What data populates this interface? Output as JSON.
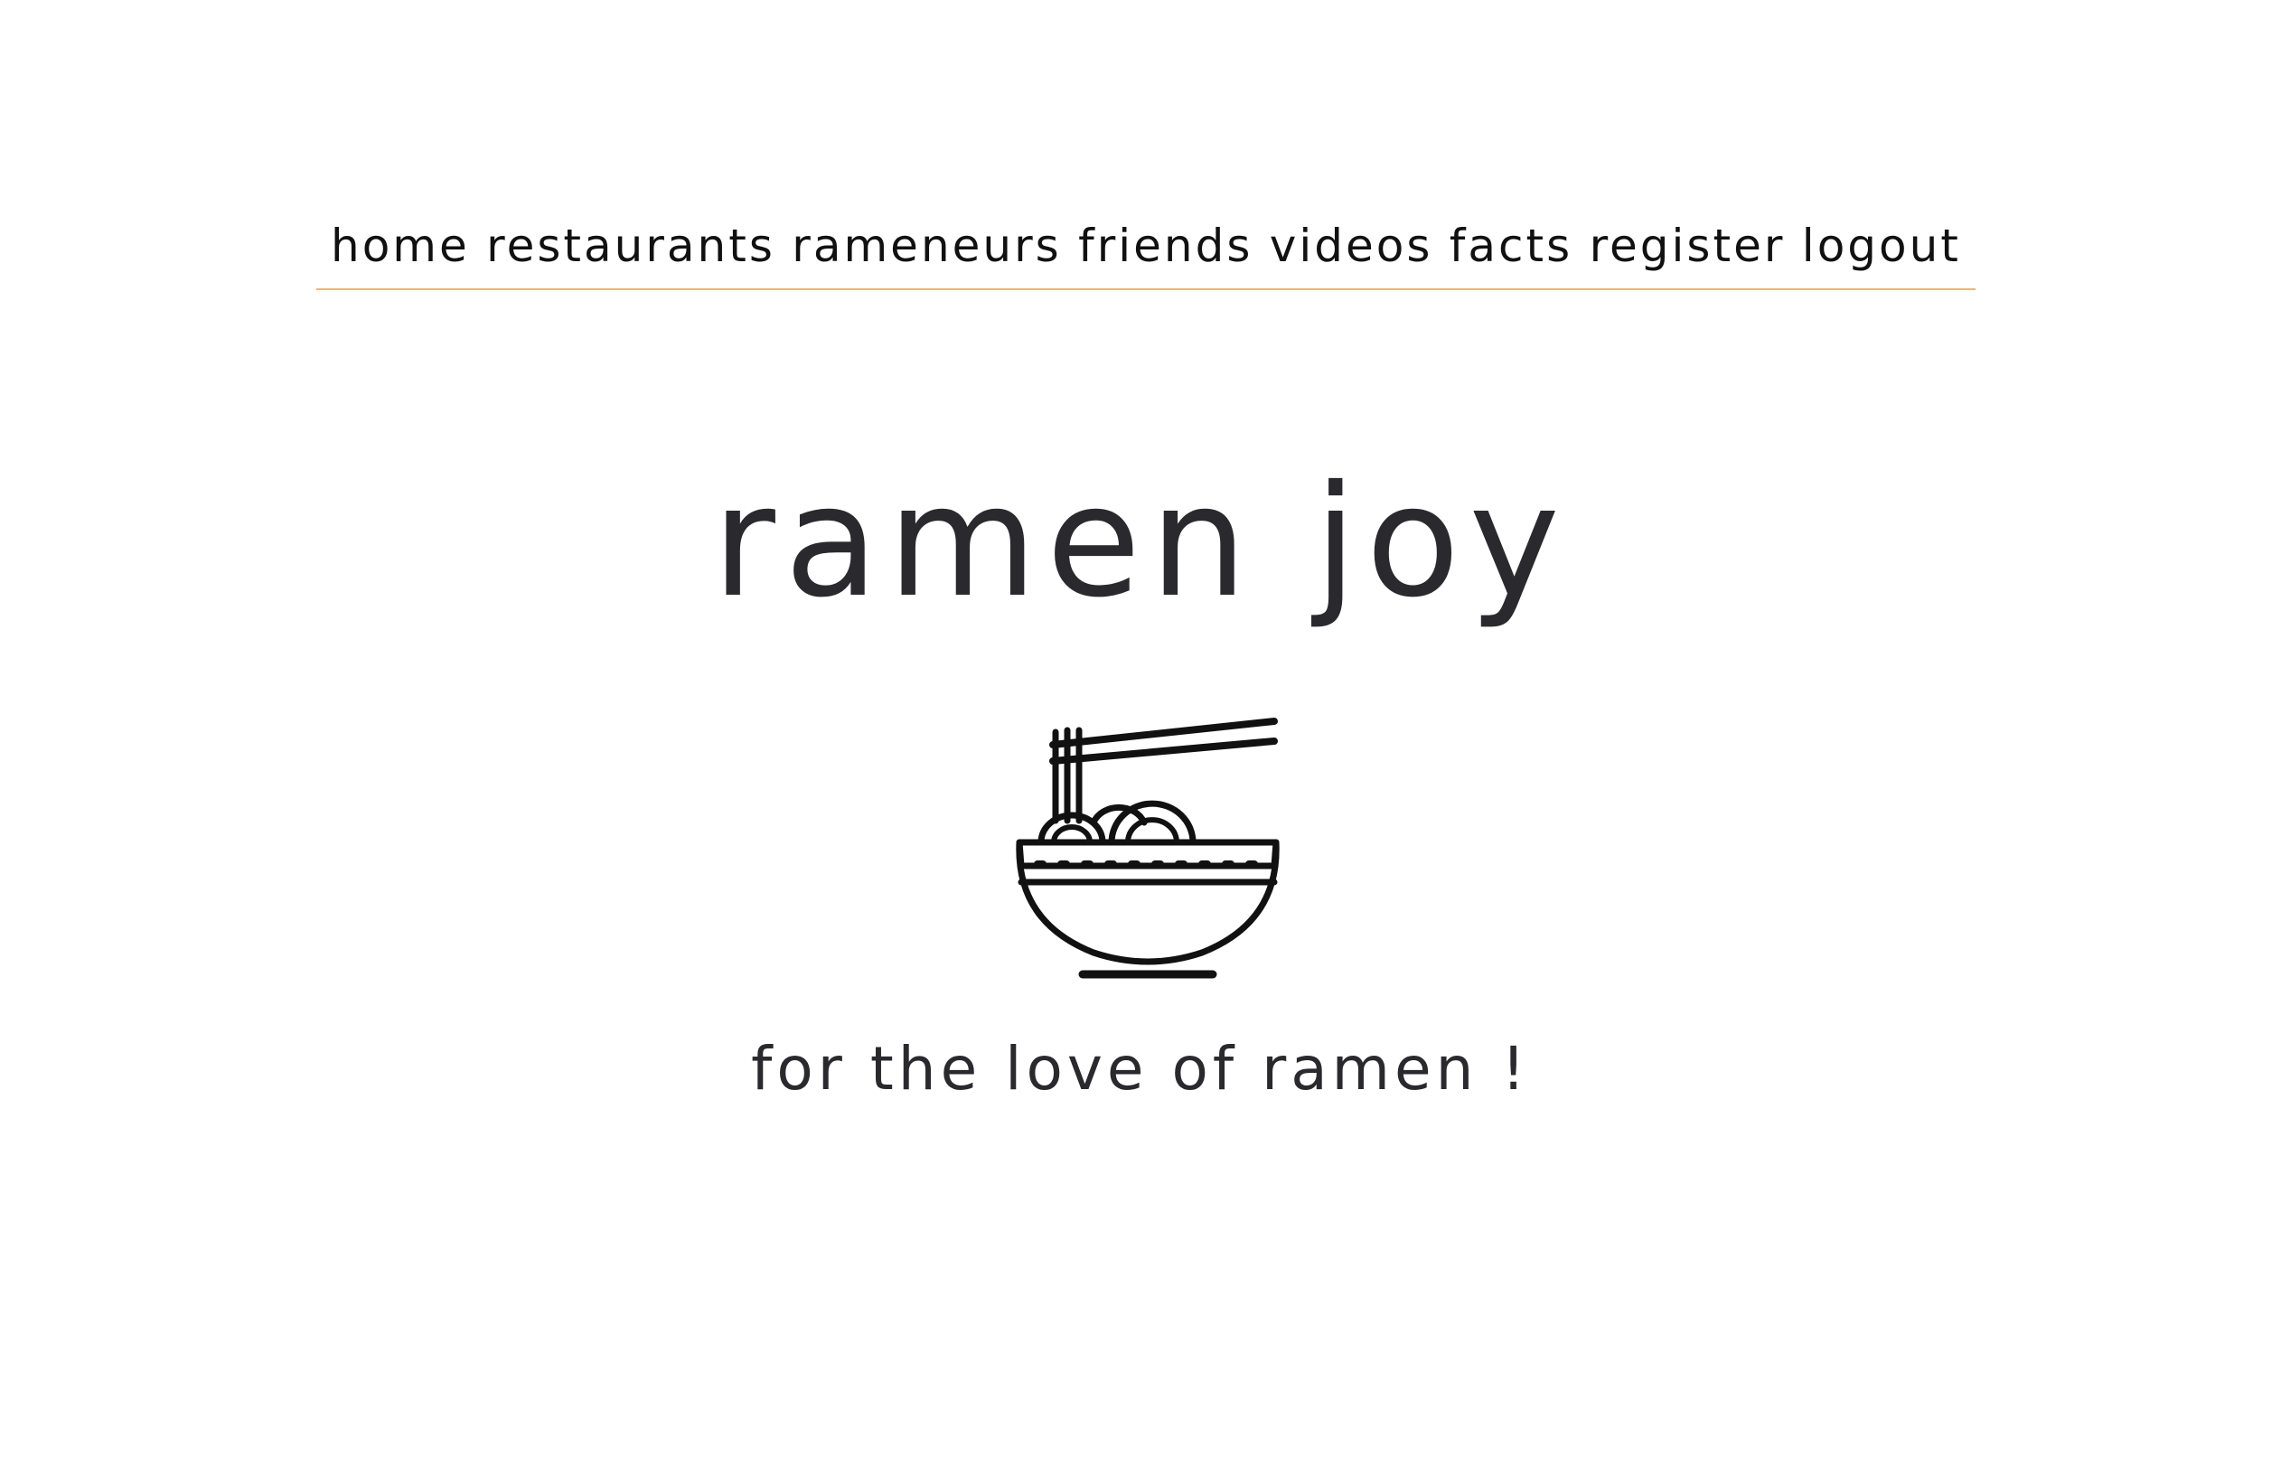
{
  "nav": {
    "items": [
      {
        "label": "home"
      },
      {
        "label": "restaurants"
      },
      {
        "label": "rameneurs"
      },
      {
        "label": "friends"
      },
      {
        "label": "videos"
      },
      {
        "label": "facts"
      },
      {
        "label": "register"
      },
      {
        "label": "logout"
      }
    ],
    "rule_color": "#f0b56a"
  },
  "hero": {
    "title": "ramen joy",
    "icon": "ramen-bowl-icon",
    "tagline": "for the love of ramen !"
  },
  "colors": {
    "background": "#ffffff",
    "text": "#2a2a2e",
    "accent": "#f0b56a"
  }
}
